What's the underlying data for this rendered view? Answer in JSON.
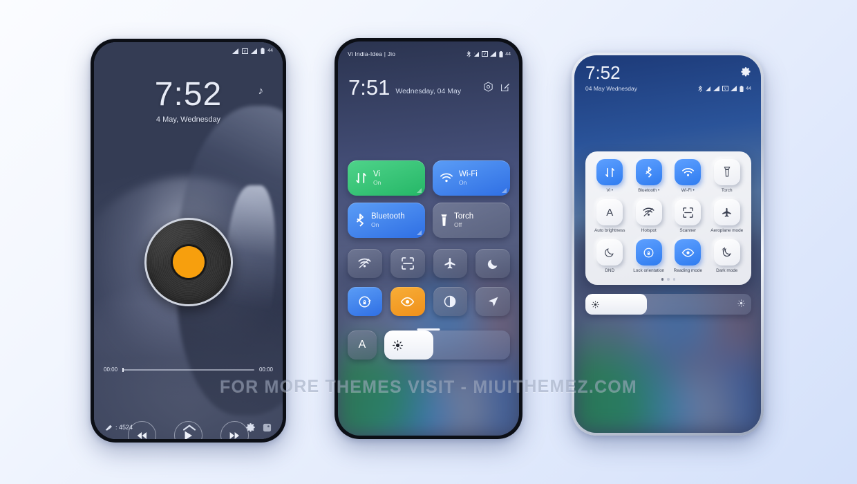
{
  "background": {
    "from": "#fbfcff",
    "to": "#d3e0fa"
  },
  "watermark": {
    "text": "FOR MORE THEMES VISIT - MIUITHEMEZ.COM"
  },
  "phone1": {
    "name": "lockscreen-music-player",
    "statusbar": {
      "battery": "44",
      "icons": [
        "signal-icon",
        "vowifi-icon",
        "signal-icon",
        "battery-icon"
      ]
    },
    "time": "7:52",
    "date": "4 May, Wednesday",
    "music_note_icon": "music-note-icon",
    "album_art": {
      "type": "vinyl-record",
      "center_color": "#f79f0d"
    },
    "seek": {
      "elapsed": "00:00",
      "total": "00:00",
      "progress_percent": 0
    },
    "controls": [
      {
        "name": "previous-button",
        "icon": "rewind-icon"
      },
      {
        "name": "play-button",
        "icon": "play-icon"
      },
      {
        "name": "next-button",
        "icon": "fast-forward-icon"
      }
    ],
    "footer": {
      "count_label": ": 4524",
      "count_icon": "pick-icon",
      "up_icon": "chevron-up-icon",
      "settings_icon": "gear-icon",
      "extra_icon": "app-icon"
    }
  },
  "phone2": {
    "name": "control-center-dark",
    "carrier": "Vi India-Idea | Jio",
    "statusbar": {
      "battery": "44",
      "icons": [
        "bluetooth-icon",
        "vowifi-icon",
        "signal-icon",
        "sim-icon",
        "signal-icon",
        "battery-icon"
      ]
    },
    "time": "7:51",
    "date": "Wednesday, 04 May",
    "header_icons": [
      {
        "name": "settings-hex-icon",
        "glyph": "gear-hex-icon"
      },
      {
        "name": "edit-icon",
        "glyph": "pencil-square-icon"
      }
    ],
    "big_tiles": [
      {
        "name": "tile-mobile-data",
        "label": "Vi",
        "state": "On",
        "style": "green",
        "icon": "data-arrows-icon"
      },
      {
        "name": "tile-wifi",
        "label": "Wi-Fi",
        "state": "On",
        "style": "blue",
        "icon": "wifi-icon"
      },
      {
        "name": "tile-bluetooth",
        "label": "Bluetooth",
        "state": "On",
        "style": "blue",
        "icon": "bluetooth-icon"
      },
      {
        "name": "tile-torch",
        "label": "Torch",
        "state": "Off",
        "style": "grey",
        "icon": "torch-icon"
      }
    ],
    "small_tiles": [
      {
        "name": "tile-hotspot",
        "icon": "hotspot-icon",
        "state": "off"
      },
      {
        "name": "tile-scanner",
        "icon": "scanner-icon",
        "state": "off"
      },
      {
        "name": "tile-aeroplane-mode",
        "icon": "aeroplane-icon",
        "state": "off"
      },
      {
        "name": "tile-dnd",
        "icon": "moon-icon",
        "state": "off"
      },
      {
        "name": "tile-lock-orientation",
        "icon": "rotation-lock-icon",
        "state": "on-blue"
      },
      {
        "name": "tile-reading-mode",
        "icon": "eye-icon",
        "state": "on-orange"
      },
      {
        "name": "tile-dark-mode",
        "icon": "contrast-icon",
        "state": "off"
      },
      {
        "name": "tile-location",
        "icon": "location-arrow-icon",
        "state": "off"
      }
    ],
    "auto_brightness": {
      "label": "A",
      "name": "auto-brightness-button"
    },
    "brightness": {
      "percent": 39,
      "icon": "sun-icon"
    }
  },
  "phone3": {
    "name": "control-center-light",
    "time": "7:52",
    "date": "04 May Wednesday",
    "settings_icon": "gear-icon",
    "statusbar": {
      "battery": "44",
      "icons": [
        "bluetooth-icon",
        "vowifi-icon",
        "signal-icon",
        "sim-icon",
        "signal-icon",
        "battery-icon"
      ]
    },
    "tiles": [
      {
        "name": "tile-mobile-data",
        "label": "Vi •",
        "icon": "data-arrows-icon",
        "state": "on"
      },
      {
        "name": "tile-bluetooth",
        "label": "Bluetooth •",
        "icon": "bluetooth-icon",
        "state": "on"
      },
      {
        "name": "tile-wifi",
        "label": "Wi-Fi •",
        "icon": "wifi-icon",
        "state": "on"
      },
      {
        "name": "tile-torch",
        "label": "Torch",
        "icon": "torch-icon",
        "state": "off"
      },
      {
        "name": "tile-auto-brightness",
        "label": "Auto brightness",
        "icon": "letter-a-icon",
        "state": "off"
      },
      {
        "name": "tile-hotspot",
        "label": "Hotspot",
        "icon": "hotspot-icon",
        "state": "off"
      },
      {
        "name": "tile-scanner",
        "label": "Scanner",
        "icon": "scanner-icon",
        "state": "off"
      },
      {
        "name": "tile-aeroplane-mode",
        "label": "Aeroplane mode",
        "icon": "aeroplane-icon",
        "state": "off"
      },
      {
        "name": "tile-dnd",
        "label": "DND",
        "icon": "moon-icon",
        "state": "off"
      },
      {
        "name": "tile-lock-orientation",
        "label": "Lock orientation",
        "icon": "rotation-lock-icon",
        "state": "on"
      },
      {
        "name": "tile-reading-mode",
        "label": "Reading mode",
        "icon": "eye-icon",
        "state": "on"
      },
      {
        "name": "tile-dark-mode",
        "label": "Dark mode",
        "icon": "dark-mode-icon",
        "state": "off"
      }
    ],
    "pages": {
      "count": 3,
      "active": 0
    },
    "brightness": {
      "percent": 37,
      "icon": "sun-icon"
    }
  }
}
